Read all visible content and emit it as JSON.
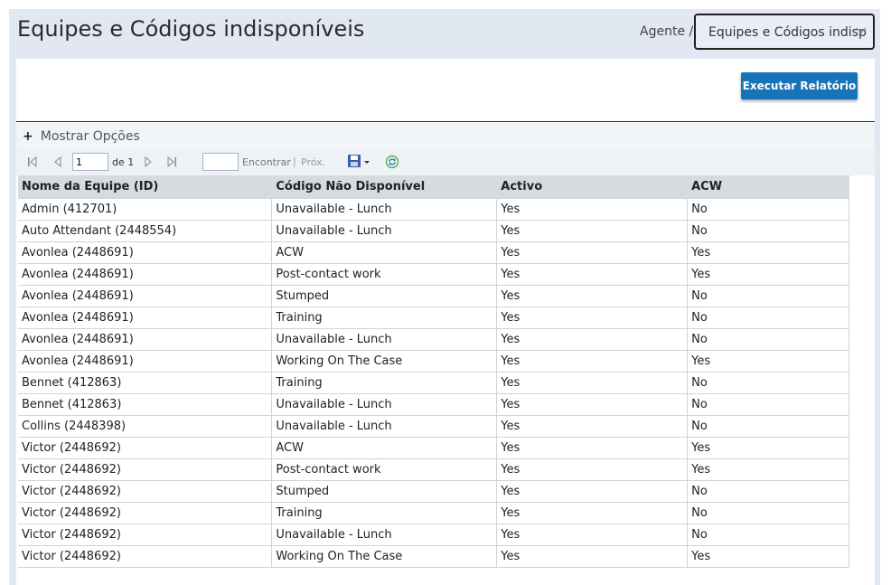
{
  "header": {
    "title": "Equipes e Códigos indisponíveis",
    "breadcrumb": "Agente /",
    "report_select_value": "Equipes e Códigos indisp"
  },
  "actions": {
    "run_report_label": "Executar Relatório"
  },
  "options": {
    "toggle_label": "Mostrar Opções"
  },
  "toolbar": {
    "page_value": "1",
    "of_label": "de 1",
    "find_label": "Encontrar",
    "separator": "|",
    "next_label": "Próx."
  },
  "table": {
    "columns": [
      "Nome da Equipe (ID)",
      "Código Não Disponível",
      "Activo",
      "ACW"
    ],
    "rows": [
      [
        "Admin (412701)",
        "Unavailable - Lunch",
        "Yes",
        "No"
      ],
      [
        "Auto Attendant (2448554)",
        "Unavailable - Lunch",
        "Yes",
        "No"
      ],
      [
        "Avonlea (2448691)",
        "ACW",
        "Yes",
        "Yes"
      ],
      [
        "Avonlea (2448691)",
        "Post-contact work",
        "Yes",
        "Yes"
      ],
      [
        "Avonlea (2448691)",
        "Stumped",
        "Yes",
        "No"
      ],
      [
        "Avonlea (2448691)",
        "Training",
        "Yes",
        "No"
      ],
      [
        "Avonlea (2448691)",
        "Unavailable - Lunch",
        "Yes",
        "No"
      ],
      [
        "Avonlea (2448691)",
        "Working On The Case",
        "Yes",
        "Yes"
      ],
      [
        "Bennet (412863)",
        "Training",
        "Yes",
        "No"
      ],
      [
        "Bennet (412863)",
        "Unavailable - Lunch",
        "Yes",
        "No"
      ],
      [
        "Collins (2448398)",
        "Unavailable - Lunch",
        "Yes",
        "No"
      ],
      [
        "Victor (2448692)",
        "ACW",
        "Yes",
        "Yes"
      ],
      [
        "Victor (2448692)",
        "Post-contact work",
        "Yes",
        "Yes"
      ],
      [
        "Victor (2448692)",
        "Stumped",
        "Yes",
        "No"
      ],
      [
        "Victor (2448692)",
        "Training",
        "Yes",
        "No"
      ],
      [
        "Victor (2448692)",
        "Unavailable - Lunch",
        "Yes",
        "No"
      ],
      [
        "Victor (2448692)",
        "Working On The Case",
        "Yes",
        "Yes"
      ]
    ]
  },
  "colors": {
    "header_bg": "#e1e8f1",
    "button_bg": "#1774b8",
    "table_header_bg": "#d6dbe0"
  },
  "icons": [
    "first-page-icon",
    "prev-page-icon",
    "next-page-icon",
    "last-page-icon",
    "save-export-icon",
    "refresh-icon",
    "chevron-down-icon",
    "plus-icon"
  ]
}
